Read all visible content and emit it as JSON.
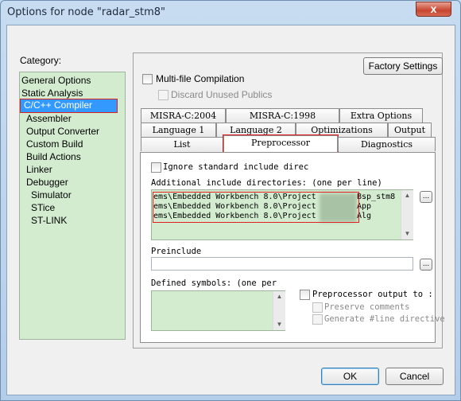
{
  "window": {
    "title": "Options for node \"radar_stm8\"",
    "close_glyph": "x"
  },
  "category": {
    "label": "Category:",
    "items": [
      {
        "label": "General Options"
      },
      {
        "label": "Static Analysis"
      },
      {
        "label": "C/C++ Compiler"
      },
      {
        "label": "Assembler"
      },
      {
        "label": "Output Converter"
      },
      {
        "label": "Custom Build"
      },
      {
        "label": "Build Actions"
      },
      {
        "label": "Linker"
      },
      {
        "label": "Debugger"
      },
      {
        "label": "Simulator"
      },
      {
        "label": "STice"
      },
      {
        "label": "ST-LINK"
      }
    ]
  },
  "panel": {
    "factory_settings": "Factory Settings",
    "multifile": "Multi-file Compilation",
    "discard": "Discard Unused Publics",
    "tabs_row1": [
      "MISRA-C:2004",
      "MISRA-C:1998",
      "Extra Options"
    ],
    "tabs_row2": [
      "Language 1",
      "Language 2",
      "Optimizations",
      "Output"
    ],
    "tabs_row3": [
      "List",
      "Preprocessor",
      "Diagnostics"
    ]
  },
  "preprocessor": {
    "ignore_std": "Ignore standard include direc",
    "additional_label": "Additional include directories: (one per line)",
    "include_lines": [
      "ems\\Embedded Workbench 8.0\\Project",
      "ems\\Embedded Workbench 8.0\\Project",
      "ems\\Embedded Workbench 8.0\\Project"
    ],
    "include_suffixes": [
      "Bsp_stm8",
      "App",
      "Alg"
    ],
    "browse": "...",
    "preinclude_label": "Preinclude",
    "preinclude_value": "",
    "defined_label": "Defined symbols: (one per",
    "pp_output": "Preprocessor output to :",
    "preserve": "Preserve comments",
    "generate": "Generate #line directive"
  },
  "buttons": {
    "ok": "OK",
    "cancel": "Cancel"
  }
}
